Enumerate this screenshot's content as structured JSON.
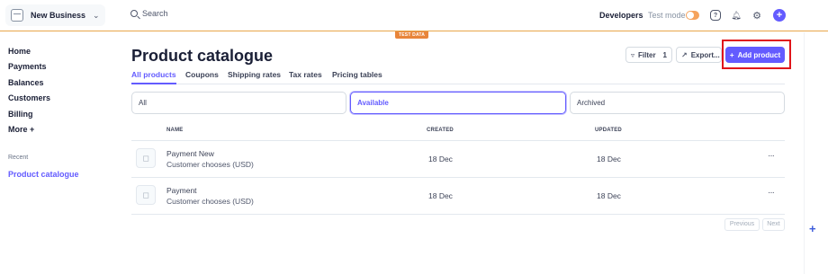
{
  "header": {
    "business_name": "New Business",
    "search_label": "Search",
    "developers_label": "Developers",
    "test_mode_label": "Test mode",
    "test_mode_on": true,
    "test_data_badge": "TEST DATA"
  },
  "sidebar": {
    "items": [
      {
        "label": "Home"
      },
      {
        "label": "Payments"
      },
      {
        "label": "Balances"
      },
      {
        "label": "Customers"
      },
      {
        "label": "Billing"
      },
      {
        "label": "More +"
      }
    ],
    "recent_label": "Recent",
    "recent_item": "Product catalogue"
  },
  "main": {
    "title": "Product catalogue",
    "filter_label": "Filter",
    "filter_count": "1",
    "export_label": "Export...",
    "add_label": "Add product",
    "tabs": [
      {
        "label": "All products"
      },
      {
        "label": "Coupons"
      },
      {
        "label": "Shipping rates"
      },
      {
        "label": "Tax rates"
      },
      {
        "label": "Pricing tables"
      }
    ],
    "segments": [
      {
        "label": "All"
      },
      {
        "label": "Available"
      },
      {
        "label": "Archived"
      }
    ],
    "columns": {
      "name": "NAME",
      "created": "CREATED",
      "updated": "UPDATED"
    },
    "rows": [
      {
        "name": "Payment New",
        "desc": "Customer chooses (USD)",
        "created": "18 Dec",
        "updated": "18 Dec"
      },
      {
        "name": "Payment",
        "desc": "Customer chooses (USD)",
        "created": "18 Dec",
        "updated": "18 Dec"
      }
    ],
    "prev_label": "Previous",
    "next_label": "Next"
  },
  "colors": {
    "accent": "#635bff",
    "test_mode": "#f5a35d",
    "highlight": "#e0151b"
  }
}
